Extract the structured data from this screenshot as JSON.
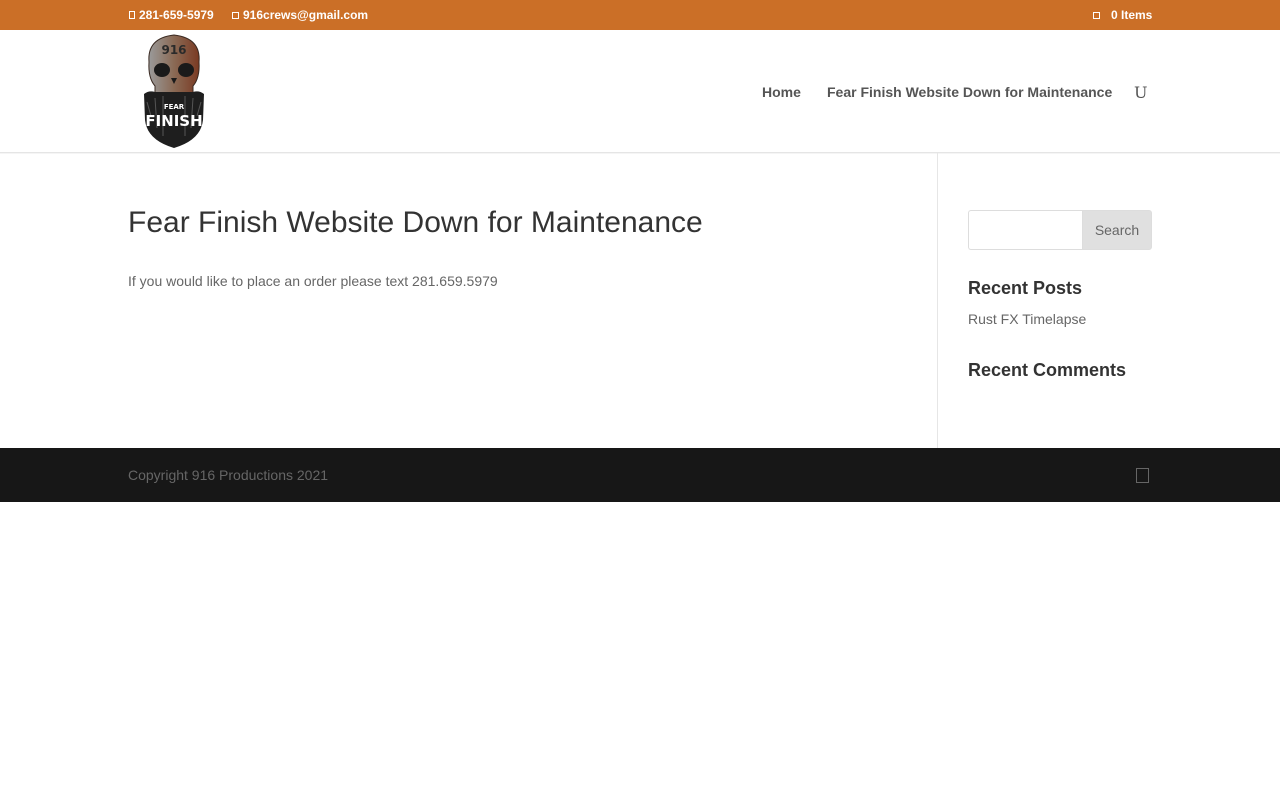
{
  "topbar": {
    "phone": "281-659-5979",
    "email": "916crews@gmail.com",
    "cart": "0 Items",
    "phone_icon": "phone-icon",
    "email_icon": "email-icon",
    "cart_icon": "cart-icon",
    "background": "#cb6f27"
  },
  "logo": {
    "top_text": "916",
    "wordmark_top": "FEAR",
    "wordmark_bottom": "FINISH"
  },
  "nav": {
    "items": [
      {
        "label": "Home"
      },
      {
        "label": "Fear Finish Website Down for Maintenance"
      }
    ],
    "search_glyph": "U"
  },
  "main": {
    "title": "Fear Finish Website Down for Maintenance",
    "body": "If you would like to place an order please text 281.659.5979"
  },
  "sidebar": {
    "search": {
      "placeholder": "",
      "button_label": "Search"
    },
    "recent_posts": {
      "title": "Recent Posts",
      "items": [
        {
          "label": "Rust FX Timelapse"
        }
      ]
    },
    "recent_comments": {
      "title": "Recent Comments"
    }
  },
  "footer": {
    "copyright": "Copyright 916 Productions 2021",
    "social_icon": "social-icon"
  }
}
